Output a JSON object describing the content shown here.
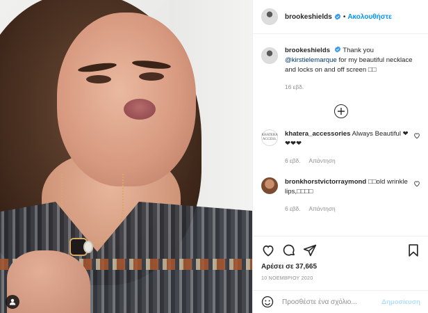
{
  "post": {
    "username": "brookeshields",
    "follow_label": "Ακολουθήστε",
    "separator": "•"
  },
  "caption": {
    "username": "brookeshields",
    "text_before": "Thank you",
    "mention": "@kirstielemarque",
    "text_after": "for my beautiful necklace and locks on and off screen",
    "emoji": "□□",
    "time": "16 εβδ."
  },
  "comments": [
    {
      "username": "khatera_accessories",
      "text": "Always Beautiful ❤❤❤❤",
      "time": "6 εβδ.",
      "reply_label": "Απάντηση",
      "avatar_text": "KHATERA ACCESS."
    },
    {
      "username": "bronkhorstvictorraymond",
      "text_pre": "□□",
      "text": "old wrinkle lips,□□□□",
      "time": "6 εβδ.",
      "reply_label": "Απάντηση"
    }
  ],
  "likes": "Αρέσει σε 37,665",
  "date": "10 ΝΟΕΜΒΡΙΟΥ 2020",
  "comment_input": {
    "placeholder": "Προσθέστε ένα σχόλιο...",
    "post_label": "Δημοσίευση"
  },
  "colors": {
    "accent": "#0095f6",
    "verified": "#3897f0",
    "post_disabled": "#b2dffc"
  },
  "icons": [
    "user-tag-icon",
    "verified-icon",
    "plus-circle-icon",
    "heart-icon",
    "comment-icon",
    "share-icon",
    "bookmark-icon",
    "emoji-icon"
  ]
}
